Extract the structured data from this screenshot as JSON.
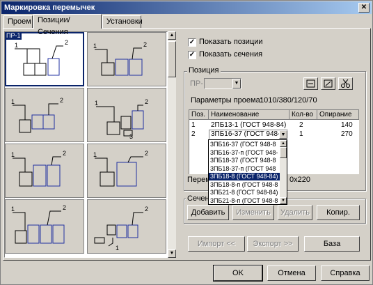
{
  "window": {
    "title": "Маркировка перемычек",
    "close_glyph": "✕"
  },
  "tabs": [
    {
      "label": "Проем",
      "active": false
    },
    {
      "label": "Позиции/Сечения",
      "active": true
    },
    {
      "label": "Установки",
      "active": false
    }
  ],
  "gallery": {
    "selected_label": "ПР-1",
    "cells": [
      {
        "labels": [
          "1",
          "2"
        ]
      },
      {
        "labels": [
          "1",
          "2"
        ]
      },
      {
        "labels": [
          "1",
          "2"
        ]
      },
      {
        "labels": [
          "1",
          "2",
          "3"
        ]
      },
      {
        "labels": [
          "1",
          "2"
        ]
      },
      {
        "labels": [
          "1",
          "2"
        ]
      },
      {
        "labels": [
          "1",
          "2"
        ]
      },
      {
        "labels": [
          "2",
          "1"
        ]
      }
    ]
  },
  "options": {
    "show_positions": {
      "label": "Показать позиции",
      "checked": true
    },
    "show_sections": {
      "label": "Показать сечения",
      "checked": true
    }
  },
  "position": {
    "group_title": "Позиция",
    "prefix": "ПР-",
    "params_label": "Параметры проема:",
    "params_value": "1010/380/120/70",
    "table": {
      "headers": [
        "Поз.",
        "Наименование",
        "Кол-во",
        "Опирание"
      ],
      "rows": [
        {
          "pos": "1",
          "name": "2ПБ13-1 (ГОСТ 948-84)",
          "qty": "2",
          "support": "140"
        },
        {
          "pos": "2",
          "name": "3ПБ16-37 (ГОСТ 948-8",
          "qty": "1",
          "support": "270"
        }
      ]
    },
    "dropdown_items": [
      "3ПБ16-37 (ГОСТ 948-8",
      "3ПБ16-37-п (ГОСТ 948-",
      "3ПБ18-37 (ГОСТ 948-8",
      "3ПБ18-37-п (ГОСТ 948",
      "3ПБ18-8 (ГОСТ 948-84)",
      "3ПБ18-8-п (ГОСТ 948-8",
      "3ПБ21-8 (ГОСТ 948-84)",
      "3ПБ21-8-п (ГОСТ 948-8"
    ],
    "highlighted_index": 4,
    "section_label_prefix": "Перем",
    "section_label_suffix": "0x220"
  },
  "sections": {
    "group_title": "Сечен",
    "add": "Добавить",
    "edit": "Изменить",
    "delete": "Удалить",
    "copy": "Копир."
  },
  "bottom": {
    "import": "Импорт <<",
    "export": "Экспорт >>",
    "base": "База",
    "ok": "OK",
    "cancel": "Отмена",
    "help": "Справка"
  }
}
